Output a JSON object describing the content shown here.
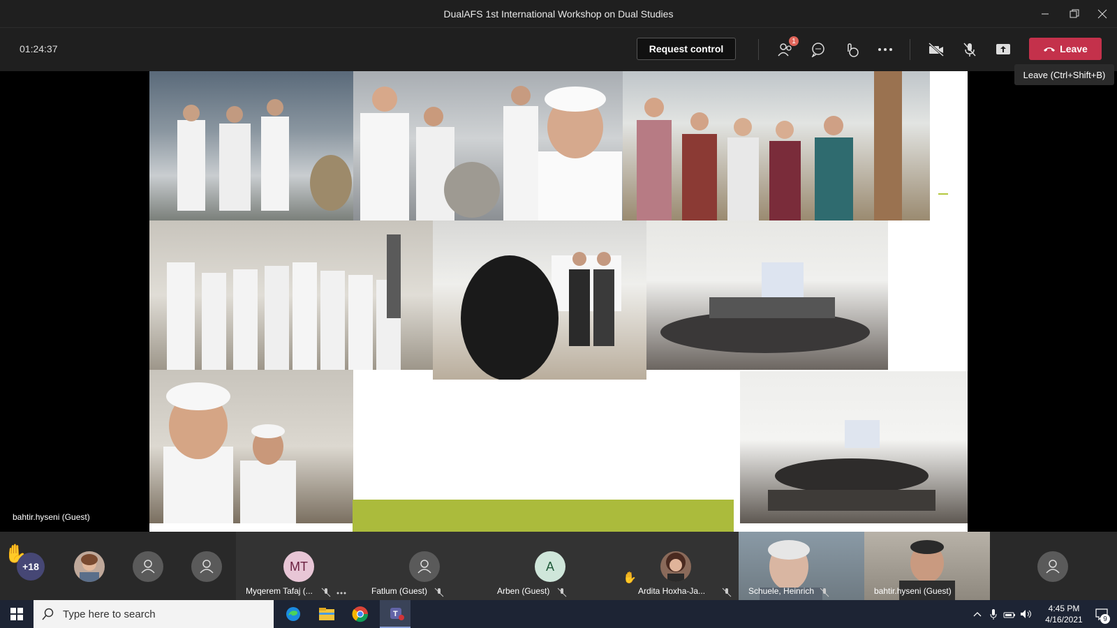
{
  "window": {
    "title": "DualAFS 1st International Workshop on Dual Studies"
  },
  "toolbar": {
    "timer": "01:24:37",
    "request_control": "Request control",
    "participants_badge": "1",
    "leave_label": "Leave",
    "leave_tooltip": "Leave (Ctrl+Shift+B)"
  },
  "stage": {
    "presenter_label": "bahtir.hyseni (Guest)"
  },
  "participants": {
    "overflow_count": "+18",
    "tiles": [
      {
        "initials": "MT",
        "name": "Myqerem Tafaj (..."
      },
      {
        "name": "Fatlum (Guest)"
      },
      {
        "initials": "A",
        "name": "Arben (Guest)"
      },
      {
        "name": "Ardita Hoxha-Ja..."
      },
      {
        "name": "Schuele, Heinrich"
      },
      {
        "name": "bahtir.hyseni (Guest)"
      }
    ]
  },
  "taskbar": {
    "search_placeholder": "Type here to search",
    "time": "4:45 PM",
    "date": "4/16/2021",
    "notifications": "9"
  },
  "colors": {
    "leave": "#c4314b",
    "accent_green": "#abbb3c",
    "mt_avatar": "#e8c6d6",
    "a_avatar": "#cfe6da"
  }
}
